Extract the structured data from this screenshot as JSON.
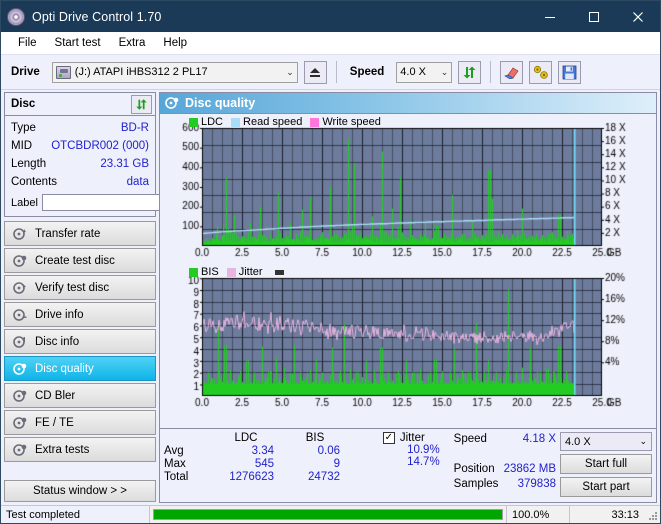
{
  "window": {
    "title": "Opti Drive Control 1.70",
    "icon": "disc-icon",
    "minimize": "–",
    "maximize": "□",
    "close": "✕"
  },
  "menu": {
    "items": [
      "File",
      "Start test",
      "Extra",
      "Help"
    ]
  },
  "toolbar": {
    "drive_label": "Drive",
    "drive_value": "(J:)   ATAPI iHBS312  2 PL17",
    "eject_icon": "eject-icon",
    "speed_label": "Speed",
    "speed_value": "4.0 X",
    "refresh_icon": "refresh-icon",
    "erase_icon": "eraser-icon",
    "tools_icon": "tools-icon",
    "save_icon": "save-icon"
  },
  "sidebar": {
    "disc_panel": {
      "title": "Disc",
      "refresh_icon": "refresh-icon",
      "rows": [
        {
          "key": "Type",
          "value": "BD-R"
        },
        {
          "key": "MID",
          "value": "OTCBDR002 (000)"
        },
        {
          "key": "Length",
          "value": "23.31 GB"
        },
        {
          "key": "Contents",
          "value": "data"
        }
      ],
      "label_key": "Label",
      "label_value": "",
      "label_button_icon": "disc-icon"
    },
    "nav_items": [
      {
        "label": "Transfer rate",
        "icon": "disc-transfer-icon",
        "active": false
      },
      {
        "label": "Create test disc",
        "icon": "disc-create-icon",
        "active": false
      },
      {
        "label": "Verify test disc",
        "icon": "disc-verify-icon",
        "active": false
      },
      {
        "label": "Drive info",
        "icon": "drive-info-icon",
        "active": false
      },
      {
        "label": "Disc info",
        "icon": "disc-info-icon",
        "active": false
      },
      {
        "label": "Disc quality",
        "icon": "disc-quality-icon",
        "active": true
      },
      {
        "label": "CD Bler",
        "icon": "cd-bler-icon",
        "active": false
      },
      {
        "label": "FE / TE",
        "icon": "fe-te-icon",
        "active": false
      },
      {
        "label": "Extra tests",
        "icon": "extra-tests-icon",
        "active": false
      }
    ],
    "status_button": "Status window > >"
  },
  "main": {
    "panel_title": "Disc quality",
    "panel_icon": "disc-quality-icon"
  },
  "stats": {
    "headers": {
      "ldc": "LDC",
      "bis": "BIS",
      "jitter": "Jitter"
    },
    "jitter_checked": true,
    "rows": [
      {
        "key": "Avg",
        "ldc": "3.34",
        "bis": "0.06",
        "jitter": "10.9%"
      },
      {
        "key": "Max",
        "ldc": "545",
        "bis": "9",
        "jitter": "14.7%"
      },
      {
        "key": "Total",
        "ldc": "1276623",
        "bis": "24732",
        "jitter": ""
      }
    ],
    "speed_key": "Speed",
    "speed_value": "4.18 X",
    "position_key": "Position",
    "position_value": "23862 MB",
    "samples_key": "Samples",
    "samples_value": "379838",
    "speed_select": "4.0 X",
    "start_full": "Start full",
    "start_part": "Start part"
  },
  "statusbar": {
    "message": "Test completed",
    "percent_label": "100.0%",
    "percent_value": 100,
    "time": "33:13"
  },
  "colors": {
    "accent": "#0fb4e8",
    "plot_bg": "#6d7c9c",
    "grid": "#2a3040",
    "ldc_green": "#22cc22",
    "bis_green": "#22cc22",
    "read_speed": "#a9dcf5",
    "write_speed": "#ff77dd",
    "jitter_pink": "#e8b4e0",
    "value_blue": "#2222cc",
    "progress_green": "#00a600",
    "title_bar": "#1b3a57"
  },
  "chart_data": [
    {
      "type": "line",
      "name": "top-chart",
      "title": "",
      "xlabel": "GB",
      "xlim": [
        0,
        25.0
      ],
      "xticks": [
        "0.0",
        "2.5",
        "5.0",
        "7.5",
        "10.0",
        "12.5",
        "15.0",
        "17.5",
        "20.0",
        "22.5",
        "25.0"
      ],
      "x_unit": "GB",
      "ylabel_left": "LDC",
      "ylim_left": [
        0,
        600
      ],
      "yticks_left": [
        "600",
        "500",
        "400",
        "300",
        "200",
        "100"
      ],
      "ylabel_right": "Speed",
      "ylim_right": [
        0,
        18
      ],
      "yticks_right": [
        "18 X",
        "16 X",
        "14 X",
        "12 X",
        "10 X",
        "8 X",
        "6 X",
        "4 X",
        "2 X"
      ],
      "legend": [
        {
          "label": "LDC",
          "color": "#22cc22"
        },
        {
          "label": "Read speed",
          "color": "#a9dcf5"
        },
        {
          "label": "Write speed",
          "color": "#ff77dd"
        }
      ],
      "data_end_gb": 23.3,
      "series": [
        {
          "name": "LDC",
          "type": "bar",
          "color": "#22cc22",
          "values": [
            18,
            22,
            30,
            25,
            40,
            60,
            35,
            28,
            55,
            345,
            90,
            75,
            155,
            60,
            45,
            38,
            50,
            42,
            70,
            120,
            48,
            35,
            60,
            200,
            55,
            44,
            90,
            62,
            38,
            50,
            270,
            66,
            40,
            55,
            48,
            120,
            35,
            60,
            44,
            70,
            185,
            52,
            48,
            250,
            60,
            38,
            45,
            56,
            70,
            40,
            35,
            300,
            48,
            60,
            52,
            40,
            44,
            62,
            545,
            70,
            48,
            420,
            55,
            66,
            40,
            50,
            44,
            60,
            150,
            52,
            40,
            62,
            480,
            70,
            48,
            55,
            190,
            42,
            38,
            350,
            62,
            48,
            44,
            130,
            56,
            40,
            38,
            62,
            48,
            55,
            44,
            60,
            38,
            52,
            100,
            44,
            40,
            62,
            48,
            38,
            260,
            56,
            44,
            48,
            60,
            52,
            40,
            44,
            130,
            62,
            48,
            38,
            55,
            44,
            60,
            385,
            240,
            56,
            44,
            48,
            62,
            40,
            52,
            38,
            60,
            48,
            44,
            55,
            190,
            62,
            40,
            48,
            52,
            44,
            60,
            38,
            56,
            48,
            44,
            62,
            70,
            52,
            44,
            160,
            48,
            40,
            38,
            55,
            62,
            44
          ]
        },
        {
          "name": "Read speed",
          "type": "line",
          "color": "#a9dcf5",
          "values": [
            1.9,
            1.95,
            2.0,
            2.05,
            2.1,
            2.15,
            2.2,
            2.2,
            2.25,
            2.3,
            2.3,
            2.35,
            2.4,
            2.4,
            2.45,
            2.5,
            2.5,
            2.55,
            2.6,
            2.6,
            2.65,
            2.7,
            2.7,
            2.75,
            2.8,
            2.8,
            2.85,
            2.9,
            2.9,
            2.95,
            3.0,
            3.0,
            3.05,
            3.05,
            3.1,
            3.1,
            3.15,
            3.15,
            3.2,
            3.2,
            3.25,
            3.25,
            3.3,
            3.3,
            3.3,
            3.35,
            3.35,
            3.4,
            3.4,
            3.4,
            3.45,
            3.45,
            3.5,
            3.5,
            3.5,
            3.55,
            3.55,
            3.6,
            3.6,
            3.6,
            3.65,
            3.65,
            3.7,
            3.7,
            3.7,
            3.75,
            3.75,
            3.8,
            3.8,
            3.8,
            3.85,
            3.85,
            3.85,
            3.9,
            3.9,
            3.9,
            3.95,
            3.95,
            4.0,
            4.0,
            4.0,
            4.05,
            4.05,
            4.05,
            4.1,
            4.1,
            4.1,
            4.15,
            4.15,
            4.15,
            4.2,
            4.2,
            4.2,
            4.25,
            4.25,
            4.25,
            4.3,
            4.3,
            4.3,
            4.35
          ]
        }
      ]
    },
    {
      "type": "line",
      "name": "bottom-chart",
      "title": "",
      "xlabel": "GB",
      "xlim": [
        0,
        25.0
      ],
      "xticks": [
        "0.0",
        "2.5",
        "5.0",
        "7.5",
        "10.0",
        "12.5",
        "15.0",
        "17.5",
        "20.0",
        "22.5",
        "25.0"
      ],
      "x_unit": "GB",
      "ylabel_left": "BIS",
      "ylim_left": [
        0,
        10
      ],
      "yticks_left": [
        "10",
        "9",
        "8",
        "7",
        "6",
        "5",
        "4",
        "3",
        "2",
        "1"
      ],
      "ylabel_right": "Jitter",
      "ylim_right": [
        0,
        20
      ],
      "yticks_right": [
        "20%",
        "16%",
        "12%",
        "8%",
        "4%"
      ],
      "legend": [
        {
          "label": "BIS",
          "color": "#22cc22"
        },
        {
          "label": "Jitter",
          "color": "#e8b4e0"
        }
      ],
      "data_end_gb": 23.3,
      "series": [
        {
          "name": "BIS",
          "type": "bar",
          "color": "#22cc22",
          "values": [
            1.3,
            1.1,
            2.0,
            1.2,
            1.5,
            1.1,
            6.0,
            1.4,
            1.2,
            4.3,
            1.1,
            2.2,
            1.3,
            1.1,
            1.6,
            2.1,
            1.2,
            1.1,
            3.0,
            1.3,
            1.1,
            2.0,
            1.4,
            1.1,
            4.2,
            1.2,
            1.3,
            2.1,
            1.1,
            1.5,
            3.2,
            1.2,
            1.1,
            2.4,
            1.3,
            1.1,
            1.9,
            4.3,
            1.2,
            1.1,
            2.0,
            1.3,
            1.6,
            1.1,
            2.2,
            1.2,
            3.1,
            1.1,
            1.4,
            2.0,
            1.2,
            1.1,
            1.8,
            4.1,
            1.3,
            1.1,
            2.1,
            1.2,
            6.1,
            1.1,
            2.3,
            1.4,
            1.1,
            2.0,
            1.2,
            1.6,
            1.1,
            3.0,
            1.3,
            1.1,
            2.2,
            1.2,
            1.1,
            4.1,
            1.5,
            1.1,
            2.0,
            1.3,
            1.1,
            1.9,
            2.1,
            1.2,
            1.1,
            3.0,
            1.4,
            1.1,
            2.0,
            1.2,
            1.1,
            2.3,
            1.3,
            1.1,
            1.8,
            2.0,
            1.2,
            3.1,
            1.1,
            1.4,
            2.1,
            1.2,
            1.1,
            2.0,
            1.3,
            4.0,
            1.1,
            1.5,
            2.2,
            1.2,
            1.1,
            2.0,
            1.3,
            1.1,
            6.2,
            1.4,
            1.2,
            2.1,
            1.1,
            3.0,
            1.3,
            1.1,
            2.0,
            1.2,
            1.6,
            1.1,
            2.2,
            9.0,
            1.2,
            1.1,
            2.0,
            1.3,
            1.1,
            2.4,
            1.2,
            1.1,
            4.1,
            1.3,
            1.5,
            1.1,
            2.0,
            1.2,
            1.1,
            2.3,
            1.4,
            1.1,
            2.0,
            1.2,
            4.2,
            1.1,
            1.3,
            2.1,
            1.2,
            1.1,
            2.0
          ]
        },
        {
          "name": "Jitter",
          "type": "line",
          "color": "#e8b4e0",
          "values": [
            11.2,
            12.4,
            11.0,
            13.0,
            11.6,
            12.8,
            10.8,
            13.4,
            11.4,
            12.0,
            13.6,
            11.2,
            12.6,
            10.6,
            13.2,
            11.8,
            12.2,
            13.8,
            11.0,
            12.8,
            11.6,
            13.4,
            10.8,
            12.4,
            11.2,
            13.0,
            12.0,
            11.4,
            13.6,
            10.6,
            12.6,
            11.8,
            13.2,
            11.0,
            12.2,
            13.0,
            11.6,
            12.4,
            10.8,
            13.4,
            11.2,
            12.0,
            11.8,
            12.8,
            10.6,
            12.2,
            11.4,
            11.0,
            12.0,
            10.8,
            11.6,
            10.4,
            11.2,
            10.6,
            11.8,
            10.2,
            11.0,
            10.8,
            11.4,
            10.0,
            10.6,
            11.2,
            10.4,
            11.6,
            10.2,
            11.0,
            10.8,
            11.4,
            10.0,
            10.6,
            11.2,
            10.4,
            11.0,
            10.2,
            10.8,
            11.4,
            10.0,
            10.6,
            11.0,
            10.2,
            10.8,
            10.4,
            11.2,
            10.0,
            10.6,
            10.8,
            10.2,
            11.0,
            10.4,
            10.6,
            10.0,
            10.8,
            10.2,
            10.4,
            10.6,
            10.0,
            10.2,
            10.4,
            9.8,
            10.0,
            10.6,
            10.2,
            9.6,
            10.4,
            10.0,
            9.8,
            10.2,
            9.6,
            10.0,
            10.4,
            9.8,
            10.2,
            9.6,
            10.0,
            9.8,
            10.2,
            9.6,
            9.8,
            10.0,
            9.6,
            9.8,
            10.2,
            9.6,
            10.0,
            9.8,
            9.6,
            10.0,
            9.8,
            10.2,
            9.6,
            9.8,
            10.0,
            9.6,
            10.2,
            9.8,
            10.0,
            9.6,
            9.8,
            10.4,
            10.0,
            10.6,
            10.2,
            11.0,
            10.6,
            11.4,
            11.0,
            11.8,
            11.4,
            12.2,
            11.8,
            12.6,
            11.6
          ]
        }
      ]
    }
  ]
}
